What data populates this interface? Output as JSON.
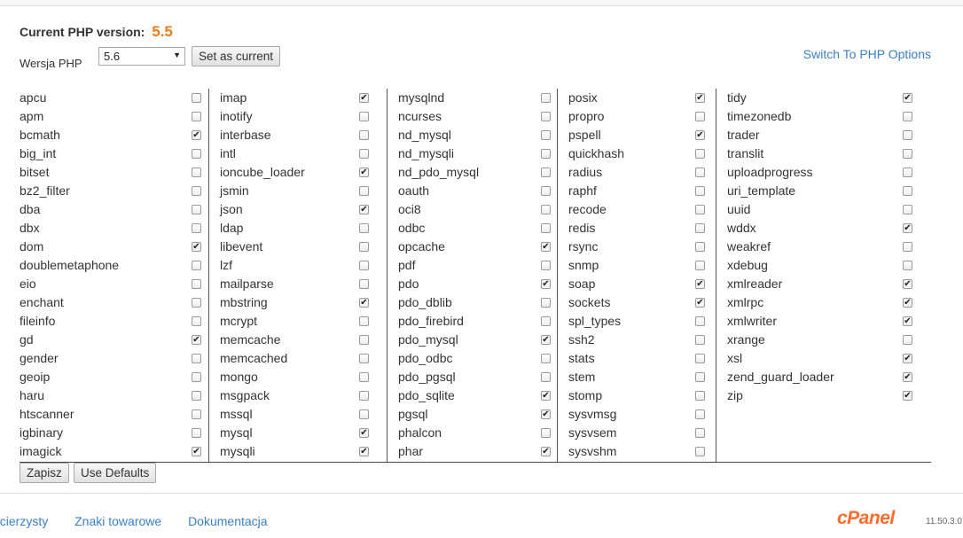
{
  "header": {
    "current_label": "Current PHP version:",
    "current_version": "5.5",
    "version_label": "Wersja PHP",
    "selected_version": "5.6",
    "set_current_button": "Set as current",
    "switch_link": "Switch To PHP Options"
  },
  "columns": [
    [
      {
        "name": "apcu",
        "checked": false
      },
      {
        "name": "apm",
        "checked": false
      },
      {
        "name": "bcmath",
        "checked": true
      },
      {
        "name": "big_int",
        "checked": false
      },
      {
        "name": "bitset",
        "checked": false
      },
      {
        "name": "bz2_filter",
        "checked": false
      },
      {
        "name": "dba",
        "checked": false
      },
      {
        "name": "dbx",
        "checked": false
      },
      {
        "name": "dom",
        "checked": true
      },
      {
        "name": "doublemetaphone",
        "checked": false
      },
      {
        "name": "eio",
        "checked": false
      },
      {
        "name": "enchant",
        "checked": false
      },
      {
        "name": "fileinfo",
        "checked": false
      },
      {
        "name": "gd",
        "checked": true
      },
      {
        "name": "gender",
        "checked": false
      },
      {
        "name": "geoip",
        "checked": false
      },
      {
        "name": "haru",
        "checked": false
      },
      {
        "name": "htscanner",
        "checked": false
      },
      {
        "name": "igbinary",
        "checked": false
      },
      {
        "name": "imagick",
        "checked": true
      }
    ],
    [
      {
        "name": "imap",
        "checked": true
      },
      {
        "name": "inotify",
        "checked": false
      },
      {
        "name": "interbase",
        "checked": false
      },
      {
        "name": "intl",
        "checked": false
      },
      {
        "name": "ioncube_loader",
        "checked": true
      },
      {
        "name": "jsmin",
        "checked": false
      },
      {
        "name": "json",
        "checked": true
      },
      {
        "name": "ldap",
        "checked": false
      },
      {
        "name": "libevent",
        "checked": false
      },
      {
        "name": "lzf",
        "checked": false
      },
      {
        "name": "mailparse",
        "checked": false
      },
      {
        "name": "mbstring",
        "checked": true
      },
      {
        "name": "mcrypt",
        "checked": false
      },
      {
        "name": "memcache",
        "checked": false
      },
      {
        "name": "memcached",
        "checked": false
      },
      {
        "name": "mongo",
        "checked": false
      },
      {
        "name": "msgpack",
        "checked": false
      },
      {
        "name": "mssql",
        "checked": false
      },
      {
        "name": "mysql",
        "checked": true
      },
      {
        "name": "mysqli",
        "checked": true
      }
    ],
    [
      {
        "name": "mysqlnd",
        "checked": false
      },
      {
        "name": "ncurses",
        "checked": false
      },
      {
        "name": "nd_mysql",
        "checked": false
      },
      {
        "name": "nd_mysqli",
        "checked": false
      },
      {
        "name": "nd_pdo_mysql",
        "checked": false
      },
      {
        "name": "oauth",
        "checked": false
      },
      {
        "name": "oci8",
        "checked": false
      },
      {
        "name": "odbc",
        "checked": false
      },
      {
        "name": "opcache",
        "checked": true
      },
      {
        "name": "pdf",
        "checked": false
      },
      {
        "name": "pdo",
        "checked": true
      },
      {
        "name": "pdo_dblib",
        "checked": false
      },
      {
        "name": "pdo_firebird",
        "checked": false
      },
      {
        "name": "pdo_mysql",
        "checked": true
      },
      {
        "name": "pdo_odbc",
        "checked": false
      },
      {
        "name": "pdo_pgsql",
        "checked": false
      },
      {
        "name": "pdo_sqlite",
        "checked": true
      },
      {
        "name": "pgsql",
        "checked": true
      },
      {
        "name": "phalcon",
        "checked": false
      },
      {
        "name": "phar",
        "checked": true
      }
    ],
    [
      {
        "name": "posix",
        "checked": true
      },
      {
        "name": "propro",
        "checked": false
      },
      {
        "name": "pspell",
        "checked": true
      },
      {
        "name": "quickhash",
        "checked": false
      },
      {
        "name": "radius",
        "checked": false
      },
      {
        "name": "raphf",
        "checked": false
      },
      {
        "name": "recode",
        "checked": false
      },
      {
        "name": "redis",
        "checked": false
      },
      {
        "name": "rsync",
        "checked": false
      },
      {
        "name": "snmp",
        "checked": false
      },
      {
        "name": "soap",
        "checked": true
      },
      {
        "name": "sockets",
        "checked": true
      },
      {
        "name": "spl_types",
        "checked": false
      },
      {
        "name": "ssh2",
        "checked": false
      },
      {
        "name": "stats",
        "checked": false
      },
      {
        "name": "stem",
        "checked": false
      },
      {
        "name": "stomp",
        "checked": false
      },
      {
        "name": "sysvmsg",
        "checked": false
      },
      {
        "name": "sysvsem",
        "checked": false
      },
      {
        "name": "sysvshm",
        "checked": false
      }
    ],
    [
      {
        "name": "tidy",
        "checked": true
      },
      {
        "name": "timezonedb",
        "checked": false
      },
      {
        "name": "trader",
        "checked": false
      },
      {
        "name": "translit",
        "checked": false
      },
      {
        "name": "uploadprogress",
        "checked": false
      },
      {
        "name": "uri_template",
        "checked": false
      },
      {
        "name": "uuid",
        "checked": false
      },
      {
        "name": "wddx",
        "checked": true
      },
      {
        "name": "weakref",
        "checked": false
      },
      {
        "name": "xdebug",
        "checked": false
      },
      {
        "name": "xmlreader",
        "checked": true
      },
      {
        "name": "xmlrpc",
        "checked": true
      },
      {
        "name": "xmlwriter",
        "checked": true
      },
      {
        "name": "xrange",
        "checked": false
      },
      {
        "name": "xsl",
        "checked": true
      },
      {
        "name": "zend_guard_loader",
        "checked": true
      },
      {
        "name": "zip",
        "checked": true
      }
    ]
  ],
  "actions": {
    "save_button": "Zapisz",
    "defaults_button": "Use Defaults"
  },
  "footer": {
    "links": [
      "acierzysty",
      "Znaki towarowe",
      "Dokumentacja"
    ],
    "logo": "cPanel",
    "version": "11.50.3.0"
  },
  "colors": {
    "accent_orange": "#f07d1a",
    "link_blue": "#3b80c5",
    "cpanel_orange": "#ff6c2c"
  },
  "icons": [
    "checkbox-icon",
    "checkmark-icon",
    "dropdown-arrow-icon"
  ]
}
